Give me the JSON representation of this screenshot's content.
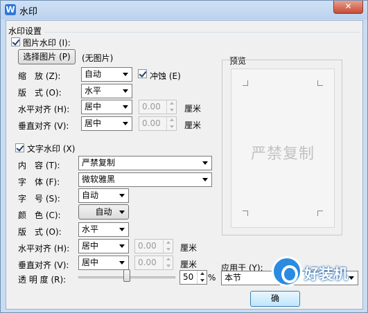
{
  "window": {
    "title": "水印",
    "app_icon": "W",
    "close_label": "✕"
  },
  "group": {
    "title": "水印设置"
  },
  "image_wm": {
    "label": "图片水印 (I):",
    "checked": true,
    "choose_button": "选择图片 (P)",
    "no_image": "(无图片)",
    "scale_label": "缩　放 (Z):",
    "scale_value": "自动",
    "washout_label": "冲蚀 (E)",
    "washout_checked": true,
    "layout_label": "版　式 (O):",
    "layout_value": "水平",
    "halign_label": "水平对齐 (H):",
    "halign_value": "居中",
    "halign_offset": "0.00",
    "valign_label": "垂直对齐 (V):",
    "valign_value": "居中",
    "valign_offset": "0.00",
    "unit": "厘米"
  },
  "text_wm": {
    "label": "文字水印 (X)",
    "checked": true,
    "content_label": "内　容 (T):",
    "content_value": "严禁复制",
    "font_label": "字　体 (F):",
    "font_value": "微软雅黑",
    "size_label": "字　号 (S):",
    "size_value": "自动",
    "color_label": "颜　色 (C):",
    "color_value": "自动",
    "layout_label": "版　式 (O):",
    "layout_value": "水平",
    "halign_label": "水平对齐 (H):",
    "halign_value": "居中",
    "halign_offset": "0.00",
    "valign_label": "垂直对齐 (V):",
    "valign_value": "居中",
    "valign_offset": "0.00",
    "unit": "厘米",
    "transparency_label": "透 明 度 (R):",
    "transparency_value": "50",
    "transparency_fraction": 0.5,
    "percent": "%"
  },
  "preview": {
    "label": "预览",
    "watermark_text": "严禁复制"
  },
  "apply": {
    "label": "应用于 (Y):",
    "value": "本节"
  },
  "buttons": {
    "ok": "确"
  },
  "logo": {
    "text": "好装机"
  },
  "colors": {
    "titlebar": "#c9dcf2",
    "close": "#c74b36",
    "ok_button": "#bee6fd"
  }
}
